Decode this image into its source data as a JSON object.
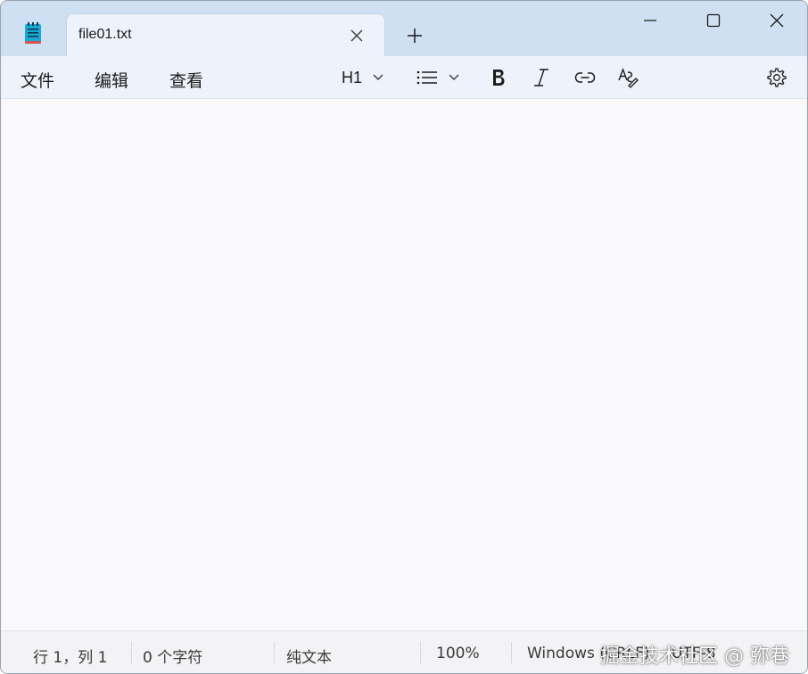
{
  "tab": {
    "title": "file01.txt"
  },
  "menu": {
    "file": "文件",
    "edit": "编辑",
    "view": "查看"
  },
  "toolbar": {
    "heading": "H1"
  },
  "status": {
    "position": "行 1，列 1",
    "chars": "0 个字符",
    "format": "纯文本",
    "zoom": "100%",
    "line_ending": "Windows (CRLF)",
    "encoding": "UTF-8"
  },
  "watermark": "掘金技术社区 @ 弥巷",
  "icons": {
    "app": "notepad-icon",
    "close_tab": "close-icon",
    "new_tab": "plus-icon",
    "minimize": "minimize-icon",
    "maximize": "maximize-icon",
    "close_window": "close-icon",
    "list": "bulleted-list-icon",
    "bold": "bold-icon",
    "italic": "italic-icon",
    "link": "link-icon",
    "clear_format": "clear-formatting-icon",
    "settings": "gear-icon"
  },
  "colors": {
    "titlebar": "#cfe0f3",
    "tab": "#eef3fb",
    "editor": "#f9f9fb",
    "statusbar": "#f3f3f5"
  }
}
